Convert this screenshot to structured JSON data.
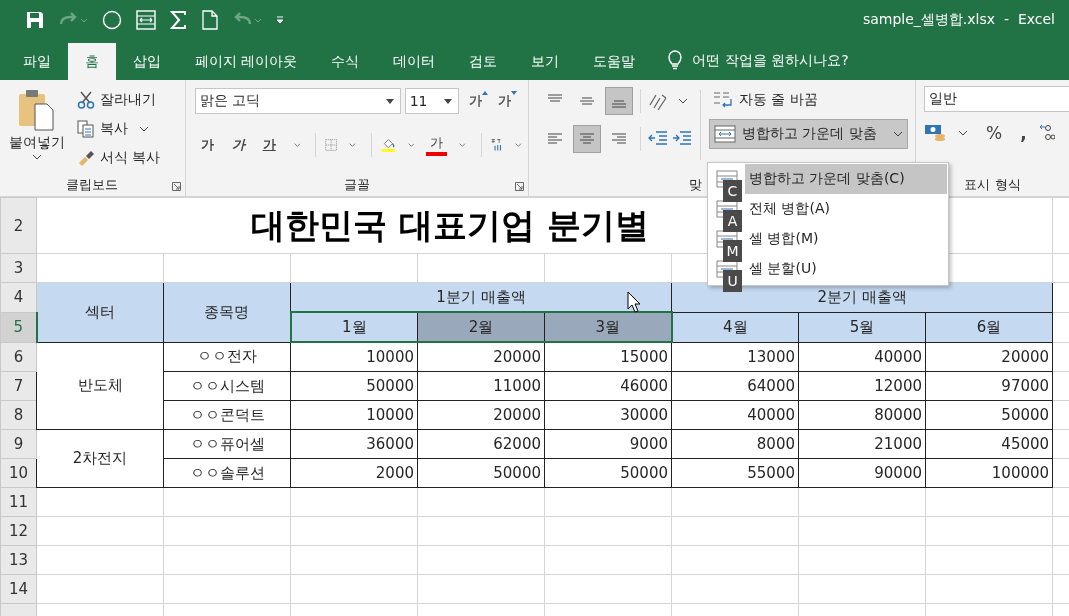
{
  "title_bar": {
    "quick_access": [
      {
        "kind": "save",
        "disabled": false
      },
      {
        "kind": "redo",
        "disabled": true
      },
      {
        "kind": "circle",
        "disabled": false
      },
      {
        "kind": "merge",
        "disabled": false
      },
      {
        "kind": "sum",
        "disabled": false
      },
      {
        "kind": "new",
        "disabled": false
      },
      {
        "kind": "undo",
        "disabled": true
      },
      {
        "kind": "customize",
        "disabled": false
      }
    ],
    "title": "sample_셀병합.xlsx  -  Excel"
  },
  "tabs": [
    {
      "label": "파일",
      "selected": false
    },
    {
      "label": "홈",
      "selected": true
    },
    {
      "label": "삽입",
      "selected": false
    },
    {
      "label": "페이지 레이아웃",
      "selected": false
    },
    {
      "label": "수식",
      "selected": false
    },
    {
      "label": "데이터",
      "selected": false
    },
    {
      "label": "검토",
      "selected": false
    },
    {
      "label": "보기",
      "selected": false
    },
    {
      "label": "도움말",
      "selected": false
    }
  ],
  "tell_me": "어떤 작업을 원하시나요?",
  "ribbon": {
    "clipboard": {
      "label": "클립보드",
      "paste": "붙여넣기",
      "cut": "잘라내기",
      "copy": "복사",
      "format_painter": "서식 복사"
    },
    "font": {
      "label": "글꼴",
      "font_name": "맑은 고딕",
      "font_size": "11",
      "grow": "가",
      "shrink": "가",
      "bold": "가",
      "italic": "가",
      "underline": "가",
      "font_color": "가"
    },
    "alignment": {
      "label": "맞",
      "vertical": [
        {
          "kind": "top",
          "selected": false
        },
        {
          "kind": "middle",
          "selected": false
        },
        {
          "kind": "bottom",
          "selected": true
        }
      ],
      "horizontal": [
        {
          "kind": "left",
          "selected": false
        },
        {
          "kind": "center",
          "selected": true
        },
        {
          "kind": "right",
          "selected": false
        }
      ],
      "wrap": "자동 줄 바꿈",
      "merge": {
        "label": "병합하고 가운데 맞춤",
        "pressed": true
      }
    },
    "number": {
      "label": "표시 형식",
      "format": "일반",
      "percent": "%",
      "comma": ","
    }
  },
  "merge_menu": [
    {
      "label": "병합하고 가운데 맞춤(C)",
      "keytip": "C",
      "highlighted": true
    },
    {
      "label": "전체 병합(A)",
      "keytip": "A",
      "highlighted": false
    },
    {
      "label": "셀 병합(M)",
      "keytip": "M",
      "highlighted": false
    },
    {
      "label": "셀 분할(U)",
      "keytip": "U",
      "highlighted": false
    }
  ],
  "sheet": {
    "row_headers": [
      {
        "label": "2",
        "selected": false
      },
      {
        "label": "3",
        "selected": false
      },
      {
        "label": "4",
        "selected": false
      },
      {
        "label": "5",
        "selected": true
      },
      {
        "label": "6",
        "selected": false
      },
      {
        "label": "7",
        "selected": false
      },
      {
        "label": "8",
        "selected": false
      },
      {
        "label": "9",
        "selected": false
      },
      {
        "label": "10",
        "selected": false
      },
      {
        "label": "11",
        "selected": false
      },
      {
        "label": "12",
        "selected": false
      },
      {
        "label": "13",
        "selected": false
      },
      {
        "label": "14",
        "selected": false
      }
    ],
    "title": "대한민국 대표기업 분기별",
    "sector_header": "섹터",
    "name_header": "종목명",
    "quarters": [
      "1분기 매출액",
      "2분기 매출액"
    ],
    "months": [
      {
        "label": "1월",
        "selected": true
      },
      {
        "label": "2월",
        "selected": true
      },
      {
        "label": "3월",
        "selected": true
      },
      {
        "label": "4월",
        "selected": false
      },
      {
        "label": "5월",
        "selected": false
      },
      {
        "label": "6월",
        "selected": false
      }
    ],
    "groups": [
      {
        "sector": "반도체",
        "rows": [
          {
            "name": "ㅇㅇ전자",
            "values": [
              "10000",
              "20000",
              "15000",
              "13000",
              "40000",
              "20000"
            ]
          },
          {
            "name": "ㅇㅇ시스템",
            "values": [
              "50000",
              "11000",
              "46000",
              "64000",
              "12000",
              "97000"
            ]
          },
          {
            "name": "ㅇㅇ콘덕트",
            "values": [
              "10000",
              "20000",
              "30000",
              "40000",
              "80000",
              "50000"
            ]
          }
        ]
      },
      {
        "sector": "2차전지",
        "rows": [
          {
            "name": "ㅇㅇ퓨어셀",
            "values": [
              "36000",
              "62000",
              "9000",
              "8000",
              "21000",
              "45000"
            ]
          },
          {
            "name": "ㅇㅇ솔루션",
            "values": [
              "2000",
              "50000",
              "50000",
              "55000",
              "90000",
              "100000"
            ]
          }
        ]
      }
    ]
  }
}
